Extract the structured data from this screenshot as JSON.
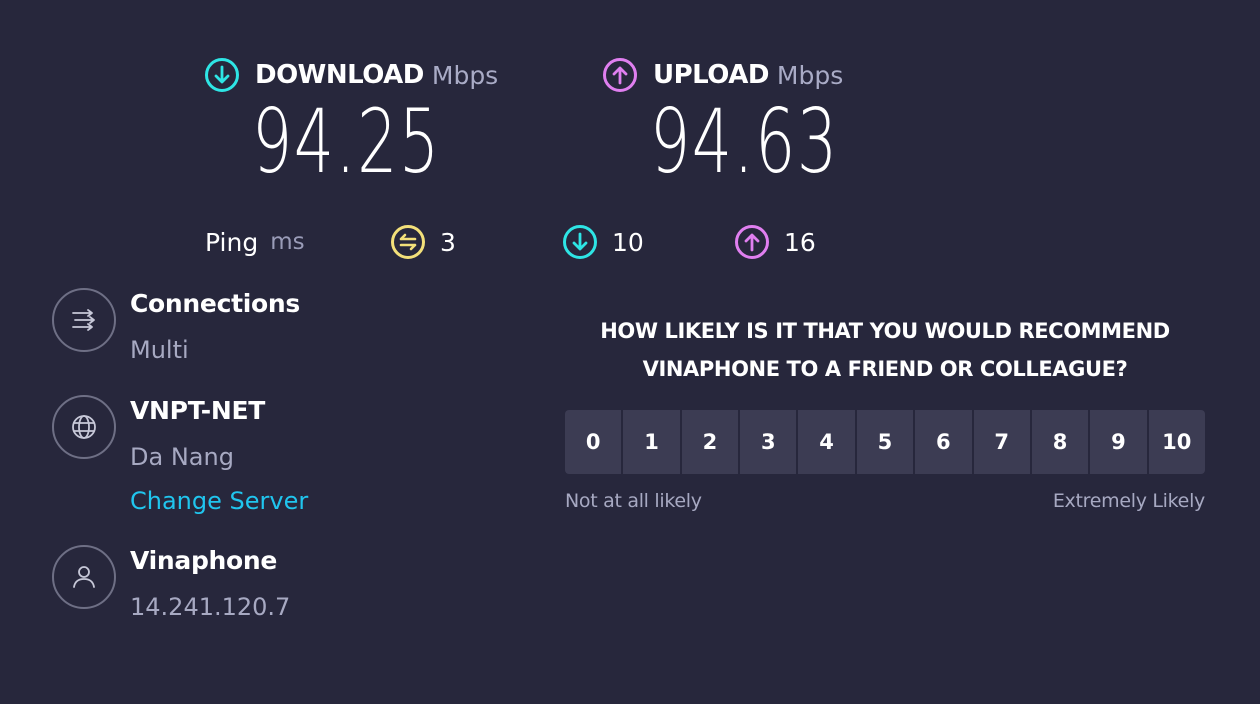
{
  "download": {
    "label": "DOWNLOAD",
    "unit": "Mbps",
    "value": "94.25",
    "icon": "arrow-down-circle-icon",
    "color": "#2ee5e5"
  },
  "upload": {
    "label": "UPLOAD",
    "unit": "Mbps",
    "value": "94.63",
    "icon": "arrow-up-circle-icon",
    "color": "#e07ff0"
  },
  "ping": {
    "label": "Ping",
    "unit": "ms",
    "idle": {
      "value": "3",
      "icon": "ping-idle-icon",
      "color": "#f3e07a"
    },
    "download": {
      "value": "10",
      "icon": "arrow-down-circle-icon",
      "color": "#2ee5e5"
    },
    "upload": {
      "value": "16",
      "icon": "arrow-up-circle-icon",
      "color": "#e07ff0"
    }
  },
  "connections": {
    "title": "Connections",
    "value": "Multi",
    "icon": "connections-icon"
  },
  "server": {
    "title": "VNPT-NET",
    "location": "Da Nang",
    "change_label": "Change Server",
    "icon": "globe-icon"
  },
  "provider": {
    "title": "Vinaphone",
    "ip": "14.241.120.7",
    "icon": "user-icon"
  },
  "survey": {
    "question_line1": "HOW LIKELY IS IT THAT YOU WOULD RECOMMEND",
    "question_line2": "VINAPHONE TO A FRIEND OR COLLEAGUE?",
    "options": [
      "0",
      "1",
      "2",
      "3",
      "4",
      "5",
      "6",
      "7",
      "8",
      "9",
      "10"
    ],
    "low_label": "Not at all likely",
    "high_label": "Extremely Likely"
  }
}
